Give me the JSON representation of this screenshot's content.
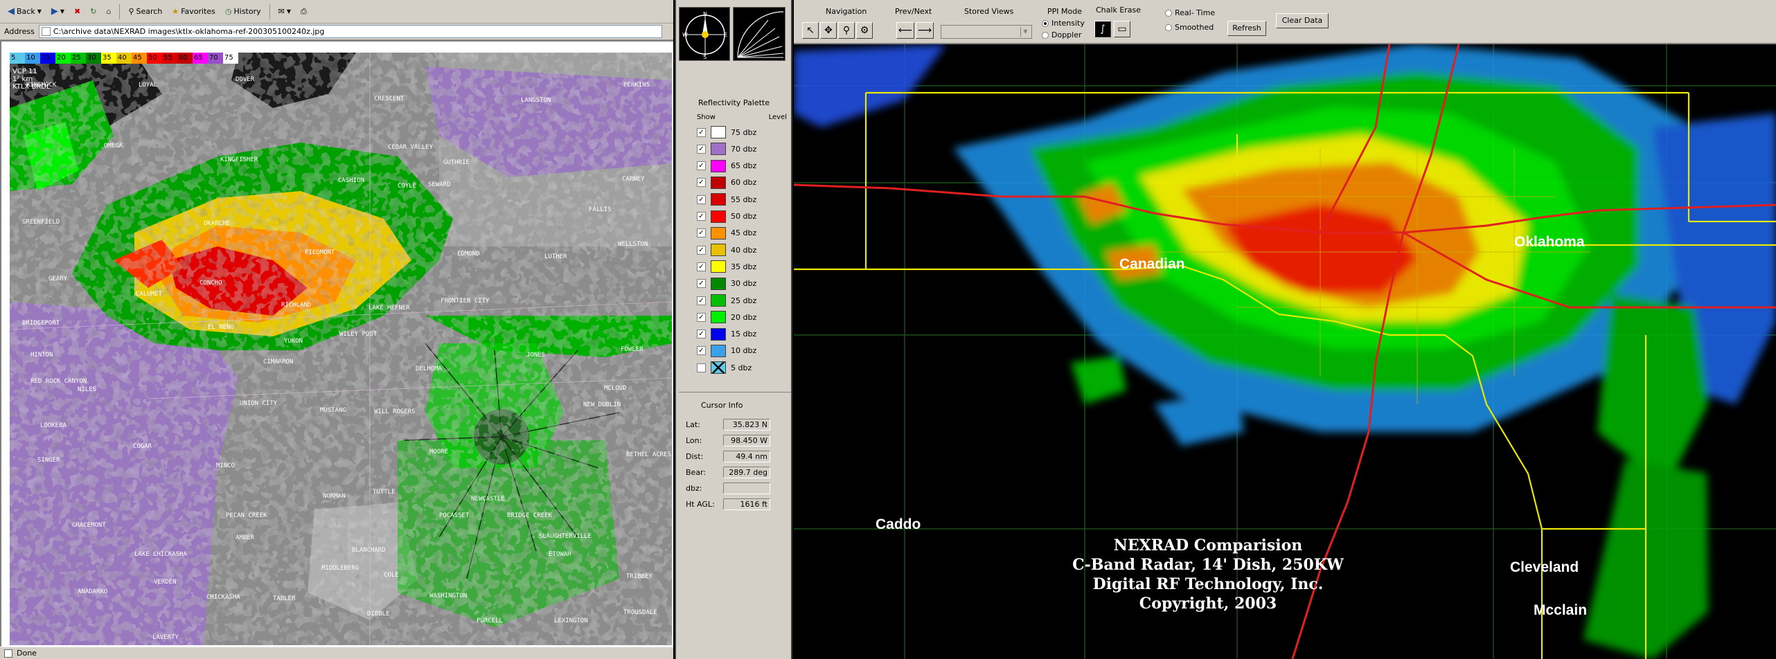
{
  "browser": {
    "toolbar": {
      "back": "Back",
      "search": "Search",
      "favorites": "Favorites",
      "history": "History"
    },
    "address": {
      "label": "Address",
      "value": "C:\\archive data\\NEXRAD images\\ktlx-oklahoma-ref-200305100240z.jpg"
    },
    "status": "Done"
  },
  "left_radar": {
    "scale": [
      "5",
      "10",
      "15",
      "20",
      "25",
      "30",
      "35",
      "40",
      "45",
      "50",
      "55",
      "60",
      "65",
      "70",
      "75"
    ],
    "scale_colors": [
      "#5bc8e8",
      "#3a9be8",
      "#0000f0",
      "#00f000",
      "#00c000",
      "#008000",
      "#ffff00",
      "#e8c800",
      "#ff9000",
      "#ff0000",
      "#d80000",
      "#c00000",
      "#ff00ff",
      "#9850c8",
      "#ffffff"
    ],
    "vcp": [
      "VCP 11",
      "1² km",
      "KTLX BRDL"
    ],
    "towns": [
      "KINGMOCK",
      "LOYAL",
      "DOVER",
      "CRESCENT",
      "LANGSTON",
      "PERKINS",
      "OMEGA",
      "KINGFISHER",
      "CEDAR VALLEY",
      "GUTHRIE",
      "CASHION",
      "COYLE",
      "SEWARD",
      "CARNEY",
      "GREENFIELD",
      "OKARCHE",
      "FALLIS",
      "WELLSTON",
      "PIEDMONT",
      "EDMOND",
      "LUTHER",
      "GEARY",
      "CALUMET",
      "CONCHO",
      "RICHLAND",
      "LAKE HEFNER",
      "FRONTIER CITY",
      "BRIDGEPORT",
      "EL RENO",
      "YUKON",
      "WILEY POST",
      "JONES",
      "HINTON",
      "CIMARRON",
      "DELHOMA",
      "FOWLER",
      "RED ROCK CANYON",
      "NILES",
      "UNION CITY",
      "MUSTANG",
      "WILL ROGERS",
      "NEW DUBLIN",
      "MCLOUD",
      "LOOKEBA",
      "COGAR",
      "MOORE",
      "BETHEL ACRES",
      "SINGER",
      "MINCO",
      "TUTTLE",
      "NEWCASTLE",
      "NORMAN",
      "BRIDGE CREEK",
      "PECAN CREEK",
      "POCASSET",
      "GRACEMONT",
      "AMBER",
      "BLANCHARD",
      "SLAUGHTERVILLE",
      "ETOWAH",
      "LAKE CHICKASHA",
      "VERDEN",
      "MIDDLEBERG",
      "COLE",
      "TRIBBEY",
      "ANADARKO",
      "CHICKASHA",
      "TABLER",
      "WASHINGTON",
      "PURCELL",
      "LEXINGTON",
      "TROUSDALE",
      "LAVERTY",
      "DIBBLE"
    ]
  },
  "control_panel": {
    "palette_title": "Reflectivity Palette",
    "col_show": "Show",
    "col_level": "Level",
    "palette": [
      {
        "label": "75 dbz",
        "color": "#ffffff",
        "show": true
      },
      {
        "label": "70 dbz",
        "color": "#a070c8",
        "show": true
      },
      {
        "label": "65 dbz",
        "color": "#ff00ff",
        "show": true
      },
      {
        "label": "60 dbz",
        "color": "#c00000",
        "show": true
      },
      {
        "label": "55 dbz",
        "color": "#d80000",
        "show": true
      },
      {
        "label": "50 dbz",
        "color": "#ff0000",
        "show": true
      },
      {
        "label": "45 dbz",
        "color": "#ff9000",
        "show": true
      },
      {
        "label": "40 dbz",
        "color": "#e8c000",
        "show": true
      },
      {
        "label": "35 dbz",
        "color": "#ffff00",
        "show": true
      },
      {
        "label": "30 dbz",
        "color": "#008800",
        "show": true
      },
      {
        "label": "25 dbz",
        "color": "#00c000",
        "show": true
      },
      {
        "label": "20 dbz",
        "color": "#00f000",
        "show": true
      },
      {
        "label": "15 dbz",
        "color": "#0000f0",
        "show": true
      },
      {
        "label": "10 dbz",
        "color": "#3aa0e8",
        "show": true
      },
      {
        "label": "5 dbz",
        "color": "#5ccce8",
        "show": false
      }
    ],
    "cursor_title": "Cursor Info",
    "cursor": [
      {
        "label": "Lat:",
        "value": "35.823 N"
      },
      {
        "label": "Lon:",
        "value": "98.450 W"
      },
      {
        "label": "Dist:",
        "value": "49.4 nm"
      },
      {
        "label": "Bear:",
        "value": "289.7 deg"
      },
      {
        "label": "dbz:",
        "value": ""
      },
      {
        "label": "Ht AGL:",
        "value": "1616 ft"
      }
    ]
  },
  "app": {
    "navigation": "Navigation",
    "prev_next": "Prev/Next",
    "stored_views": "Stored Views",
    "ppi_mode": "PPI Mode",
    "intensity": "Intensity",
    "doppler": "Doppler",
    "chalk_erase": "Chalk Erase",
    "real_time": "Real- Time",
    "smoothed": "Smoothed",
    "refresh": "Refresh",
    "clear_data": "Clear Data"
  },
  "map": {
    "counties": [
      "Canadian",
      "Oklahoma",
      "Caddo",
      "Cleveland",
      "Mcclain"
    ],
    "watermark": [
      "NEXRAD Comparision",
      "C-Band Radar, 14' Dish, 250KW",
      "Digital RF Technology, Inc.",
      "Copyright, 2003"
    ]
  }
}
